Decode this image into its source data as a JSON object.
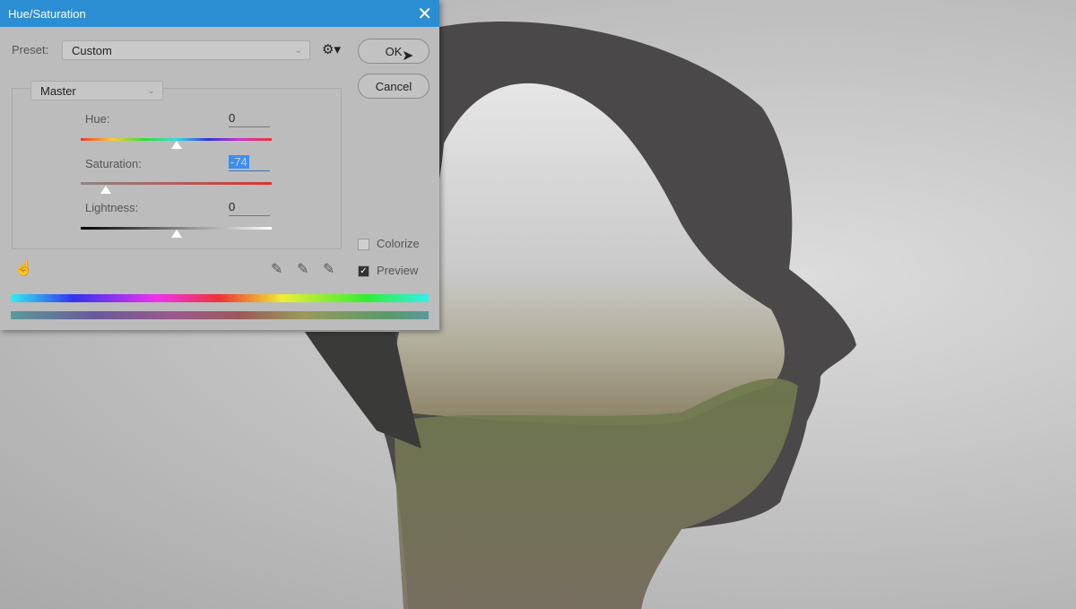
{
  "dialog": {
    "title": "Hue/Saturation",
    "close_icon": "close-icon",
    "preset_label": "Preset:",
    "preset_value": "Custom",
    "ok_label": "OK",
    "cancel_label": "Cancel",
    "channel_value": "Master",
    "hue": {
      "label": "Hue:",
      "value": "0",
      "position_percent": 50
    },
    "saturation": {
      "label": "Saturation:",
      "value": "-74",
      "position_percent": 13
    },
    "lightness": {
      "label": "Lightness:",
      "value": "0",
      "position_percent": 50
    },
    "colorize_label": "Colorize",
    "colorize_checked": false,
    "preview_label": "Preview",
    "preview_checked": true,
    "accent": "#2b8ed3"
  }
}
